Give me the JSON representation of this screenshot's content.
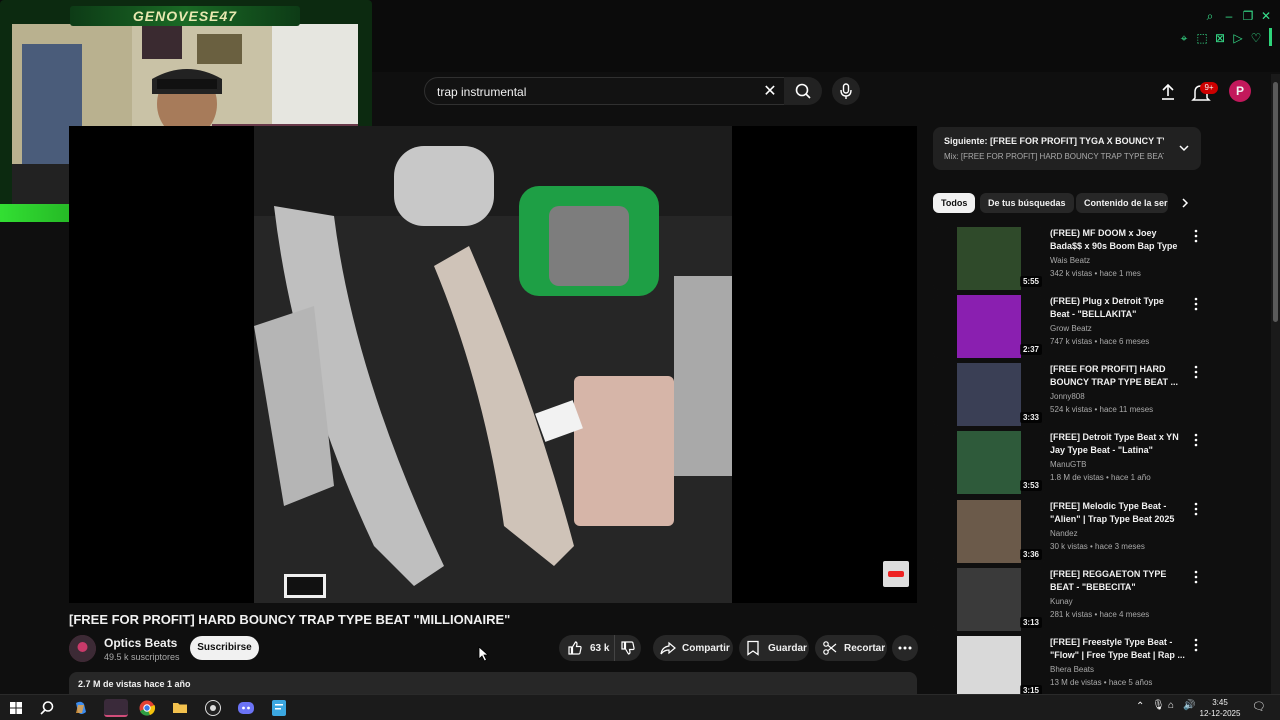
{
  "stream_overlay": {
    "streamer_name": "GENOVESE47"
  },
  "search": {
    "value": "trap instrumental"
  },
  "notifications": {
    "badge": "9+"
  },
  "account": {
    "initial": "P"
  },
  "video": {
    "title": "[FREE FOR PROFIT] HARD BOUNCY TRAP TYPE BEAT \"MILLIONAIRE\"",
    "channel": "Optics Beats",
    "subscribers": "49.5 k suscriptores",
    "subscribe_label": "Suscribirse",
    "likes": "63 k",
    "share_label": "Compartir",
    "save_label": "Guardar",
    "clip_label": "Recortar",
    "views_date": "2.7 M de vistas  hace 1 año"
  },
  "up_next": {
    "title": "Siguiente: [FREE FOR PROFIT] TYGA X BOUNCY TY...",
    "subtitle": "Mix: [FREE FOR PROFIT] HARD BOUNCY TRAP TYPE BEAT \"..."
  },
  "chips": [
    "Todos",
    "De tus búsquedas",
    "Contenido de la ser"
  ],
  "recommendations": [
    {
      "title": "(FREE) MF DOOM x Joey Bada$$ x 90s Boom Bap Type ...",
      "channel": "Wais Beatz",
      "meta": "342 k vistas • hace 1 mes",
      "duration": "5:55",
      "color": "#2f4a2a"
    },
    {
      "title": "(FREE) Plug x Detroit Type Beat - \"BELLAKITA\"",
      "channel": "Grow Beatz",
      "meta": "747 k vistas • hace 6 meses",
      "duration": "2:37",
      "color": "#8a1fb0"
    },
    {
      "title": "[FREE FOR PROFIT] HARD BOUNCY TRAP TYPE BEAT ...",
      "channel": "Jonny808",
      "meta": "524 k vistas • hace 11 meses",
      "duration": "3:33",
      "color": "#3a3f55"
    },
    {
      "title": "[FREE] Detroit Type Beat x YN Jay Type Beat - \"Latina\"",
      "channel": "ManuGTB",
      "meta": "1.8 M de vistas • hace 1 año",
      "duration": "3:53",
      "color": "#2e5a3a"
    },
    {
      "title": "[FREE] Melodic Type Beat - \"Alien\" | Trap Type Beat 2025",
      "channel": "Nandez",
      "meta": "30 k vistas • hace 3 meses",
      "duration": "3:36",
      "color": "#6b5a4a"
    },
    {
      "title": "[FREE] REGGAETON TYPE BEAT - \"BEBECITA\"",
      "channel": "Kunay",
      "meta": "281 k vistas • hace 4 meses",
      "duration": "3:13",
      "color": "#3a3a3a"
    },
    {
      "title": "[FREE] Freestyle Type Beat - \"Flow\" | Free Type Beat | Rap ...",
      "channel": "Bhera Beats",
      "meta": "13 M de vistas • hace 5 años",
      "duration": "3:15",
      "color": "#d9d9d9"
    }
  ],
  "taskbar": {
    "time": "3:45",
    "date": "12-12-2025"
  },
  "icons": [
    "windows-icon",
    "search-icon",
    "copilot-icon",
    "app-icon",
    "chrome-icon",
    "folder-icon",
    "obs-icon",
    "discord-icon",
    "notes-icon"
  ]
}
